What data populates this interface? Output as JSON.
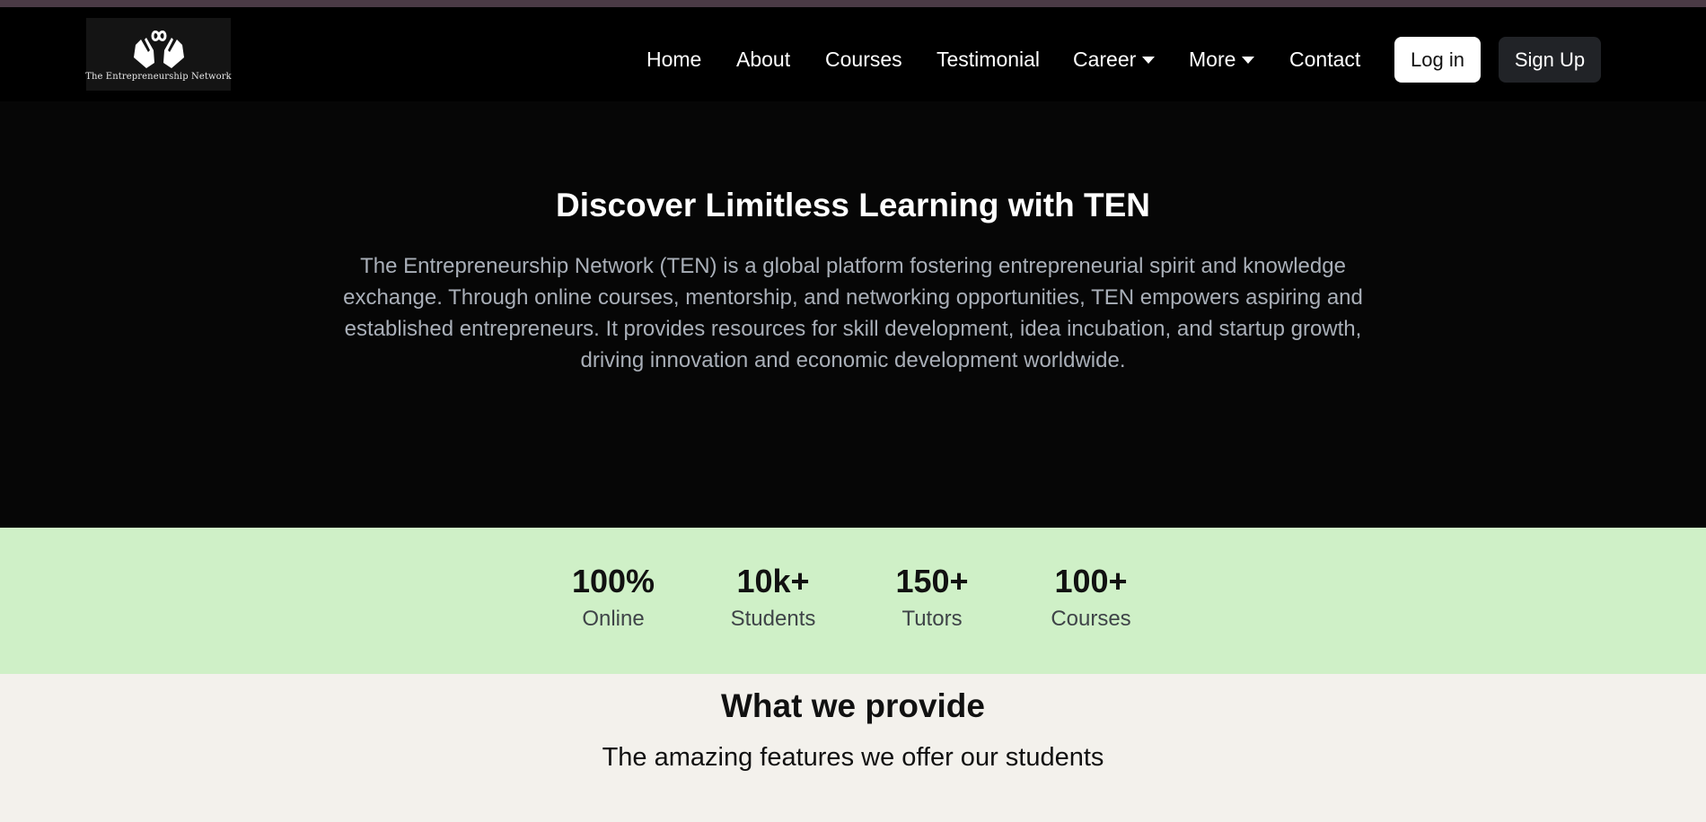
{
  "header": {
    "logo_text": "The Entrepreneurship Network",
    "logo_icon": "hands-infinity-icon",
    "nav": [
      {
        "label": "Home",
        "dropdown": false
      },
      {
        "label": "About",
        "dropdown": false
      },
      {
        "label": "Courses",
        "dropdown": false
      },
      {
        "label": "Testimonial",
        "dropdown": false
      },
      {
        "label": "Career",
        "dropdown": true
      },
      {
        "label": "More",
        "dropdown": true
      },
      {
        "label": "Contact",
        "dropdown": false
      }
    ],
    "login_label": "Log in",
    "signup_label": "Sign Up"
  },
  "hero": {
    "title": "Discover Limitless Learning with TEN",
    "description": "The Entrepreneurship Network (TEN) is a global platform fostering entrepreneurial spirit and knowledge exchange. Through online courses, mentorship, and networking opportunities, TEN empowers aspiring and established entrepreneurs. It provides resources for skill development, idea incubation, and startup growth, driving innovation and economic development worldwide."
  },
  "stats": [
    {
      "value": "100%",
      "label": "Online"
    },
    {
      "value": "10k+",
      "label": "Students"
    },
    {
      "value": "150+",
      "label": "Tutors"
    },
    {
      "value": "100+",
      "label": "Courses"
    }
  ],
  "features": {
    "title": "What we provide",
    "subtitle": "The amazing features we offer our students"
  },
  "colors": {
    "topstrip": "#4a3a45",
    "navbar": "#000000",
    "hero_bg": "#060606",
    "stats_bg": "#cff0c7",
    "page_bg": "#f3f1ec",
    "signup_bg": "#212327"
  }
}
